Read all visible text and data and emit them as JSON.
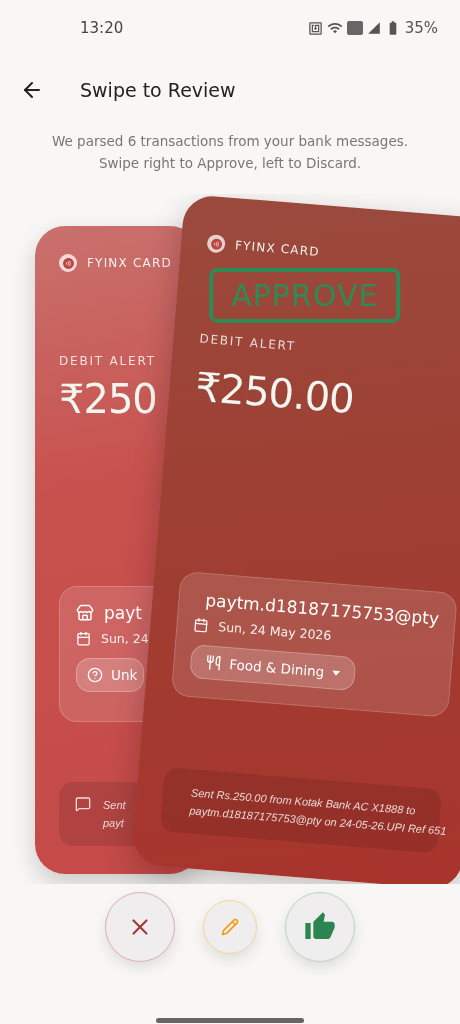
{
  "status_bar": {
    "time": "13:20",
    "battery": "35%"
  },
  "header": {
    "title": "Swipe to Review"
  },
  "intro_lines": [
    "We parsed 6 transactions from your bank messages.",
    "Swipe right to Approve, left to Discard."
  ],
  "cards": [
    {
      "kind": "back",
      "brand": "FYINX CARD",
      "label": "DEBIT ALERT",
      "amount": "₹250",
      "merchant": "payt",
      "date": "Sun, 24",
      "category": {
        "kind": "unknown",
        "label": "Unk"
      },
      "sms_lines": [
        "Sent",
        "payt"
      ]
    },
    {
      "kind": "front",
      "stamp": "APPROVE",
      "brand": "FYINX CARD",
      "label": "DEBIT ALERT",
      "amount": "₹250.00",
      "merchant": "paytm.d18187175753@pty",
      "date": "Sun, 24 May 2026",
      "category": {
        "kind": "food",
        "label": "Food & Dining"
      },
      "sms_lines": [
        "Sent Rs.250.00 from Kotak Bank AC X1888 to",
        "paytm.d18187175753@pty on 24-05-26.UPI Ref 651"
      ]
    }
  ],
  "actions": [
    {
      "kind": "discard"
    },
    {
      "kind": "edit"
    },
    {
      "kind": "approve"
    }
  ]
}
